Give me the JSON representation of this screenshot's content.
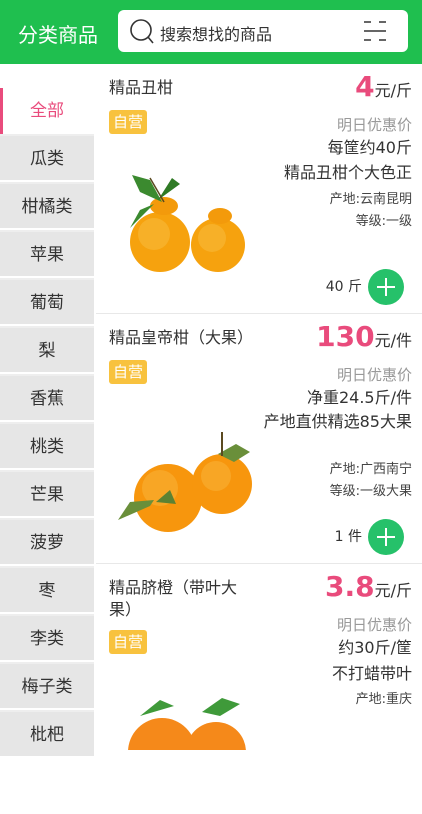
{
  "header": {
    "title": "分类商品",
    "search_placeholder": "搜索想找的商品"
  },
  "sidebar": {
    "items": [
      {
        "label": "全部",
        "active": true
      },
      {
        "label": "瓜类"
      },
      {
        "label": "柑橘类"
      },
      {
        "label": "苹果"
      },
      {
        "label": "葡萄"
      },
      {
        "label": "梨"
      },
      {
        "label": "香蕉"
      },
      {
        "label": "桃类"
      },
      {
        "label": "芒果"
      },
      {
        "label": "菠萝"
      },
      {
        "label": "枣"
      },
      {
        "label": "李类"
      },
      {
        "label": "梅子类"
      },
      {
        "label": "枇杷"
      }
    ]
  },
  "goods": [
    {
      "name": "精品丑柑",
      "tag": "自营",
      "price": "4",
      "unit": "元/斤",
      "promo": "明日优惠价",
      "spec1": "每筐约40斤",
      "spec2": "精品丑柑个大色正",
      "origin": "产地:云南昆明",
      "grade": "等级:一级",
      "qty": "40 斤"
    },
    {
      "name": "精品皇帝柑（大果）",
      "tag": "自营",
      "price": "130",
      "unit": "元/件",
      "promo": "明日优惠价",
      "spec1": "净重24.5斤/件",
      "spec2": "产地直供精选85大果",
      "origin": "产地:广西南宁",
      "grade": "等级:一级大果",
      "qty": "1 件"
    },
    {
      "name": "精品脐橙（带叶大果）",
      "tag": "自营",
      "price": "3.8",
      "unit": "元/斤",
      "promo": "明日优惠价",
      "spec1": "约30斤/筐",
      "spec2": "不打蜡带叶",
      "origin": "产地:重庆"
    }
  ],
  "colors": {
    "header": "#1fbf4f",
    "accent": "#e94b7c",
    "tag": "#f8c23e",
    "add_button": "#26c16a"
  }
}
